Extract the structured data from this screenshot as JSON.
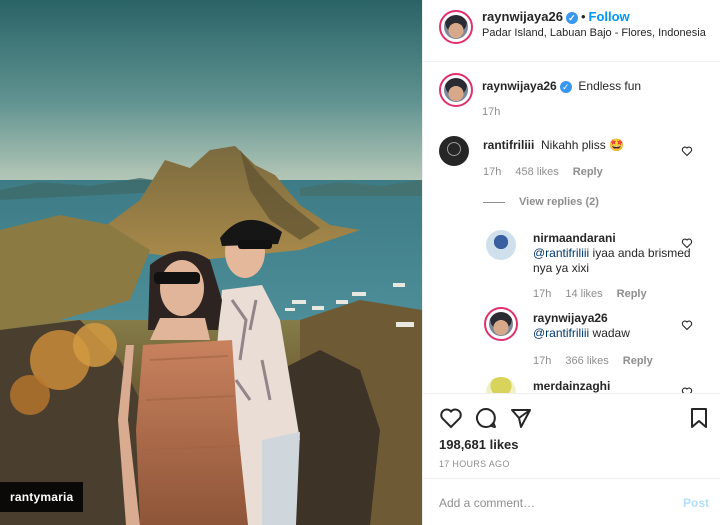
{
  "photo": {
    "tag": "rantymaria"
  },
  "header": {
    "username": "raynwijaya26",
    "separator": "•",
    "follow_label": "Follow",
    "location": "Padar Island, Labuan Bajo - Flores, Indonesia"
  },
  "caption": {
    "username": "raynwijaya26",
    "text": "Endless fun",
    "time": "17h"
  },
  "comments": [
    {
      "username": "rantifriliii",
      "text": "Nikahh pliss 🤩",
      "time": "17h",
      "likes": "458 likes",
      "reply": "Reply"
    }
  ],
  "view_replies": "View replies (2)",
  "replies": [
    {
      "username": "nirmaandarani",
      "mention": "@rantifriliii",
      "text": " iyaa anda brismed nya ya xixi",
      "time": "17h",
      "likes": "14 likes",
      "reply": "Reply"
    },
    {
      "username": "raynwijaya26",
      "mention": "@rantifriliii",
      "text": " wadaw",
      "time": "17h",
      "likes": "366 likes",
      "reply": "Reply"
    },
    {
      "username": "merdainzaghi"
    }
  ],
  "actions": {
    "likes": "198,681 likes",
    "time_ago": "17 HOURS AGO"
  },
  "add_comment": {
    "placeholder": "Add a comment…",
    "post_label": "Post"
  },
  "colors": {
    "follow": "#0095f6",
    "verified": "#3897f0",
    "muted": "#8e8e8e",
    "post_disabled": "#b2dffc"
  }
}
